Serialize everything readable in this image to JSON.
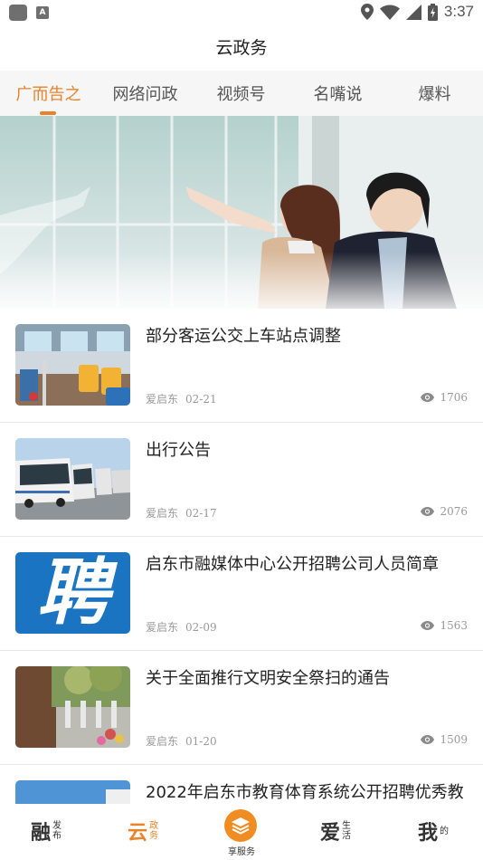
{
  "status_bar": {
    "time": "3:37",
    "keyboard_badge": "A"
  },
  "app": {
    "title": "云政务"
  },
  "tabs": [
    {
      "label": "广而告之",
      "active": true
    },
    {
      "label": "网络问政",
      "active": false
    },
    {
      "label": "视频号",
      "active": false
    },
    {
      "label": "名嘴说",
      "active": false
    },
    {
      "label": "爆料",
      "active": false
    }
  ],
  "news": [
    {
      "title": "部分客运公交上车站点调整",
      "source": "爱启东",
      "date": "02-21",
      "views": "1706",
      "thumb": "bus-interior"
    },
    {
      "title": "出行公告",
      "source": "爱启东",
      "date": "02-17",
      "views": "2076",
      "thumb": "coaches"
    },
    {
      "title": "启东市融媒体中心公开招聘公司人员简章",
      "source": "爱启东",
      "date": "02-09",
      "views": "1563",
      "thumb": "recruit-character",
      "thumb_text": "聘"
    },
    {
      "title": "关于全面推行文明安全祭扫的通告",
      "source": "爱启东",
      "date": "01-20",
      "views": "1509",
      "thumb": "cemetery"
    },
    {
      "title": "2022年启东市教育体育系统公开招聘优秀教",
      "source": "",
      "date": "",
      "views": "",
      "thumb": "school"
    }
  ],
  "bottom_nav": [
    {
      "big": "融",
      "small": "发布",
      "active": false
    },
    {
      "big": "云",
      "small": "政务",
      "active": true
    },
    {
      "label": "享服务",
      "center": true
    },
    {
      "big": "爱",
      "small": "生活",
      "active": false
    },
    {
      "big": "我",
      "small": "的",
      "active": false
    }
  ],
  "colors": {
    "accent": "#e9832a",
    "text": "#222222",
    "meta": "#9a9a9a",
    "tab_bg": "#f6f6f6"
  }
}
